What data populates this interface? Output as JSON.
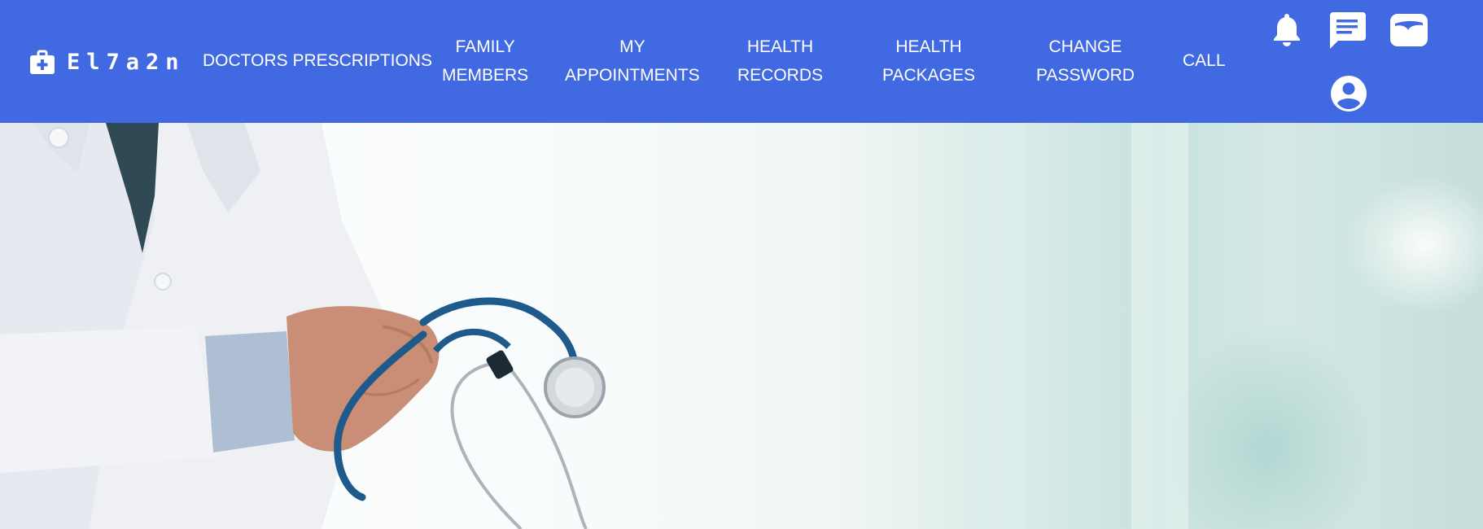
{
  "brand": {
    "name": "El7a2n",
    "icon": "medical-kit-icon"
  },
  "nav": {
    "items": [
      {
        "lines": [
          "DOCTORS PRESCRIPTIONS"
        ]
      },
      {
        "lines": [
          "FAMILY",
          "MEMBERS"
        ]
      },
      {
        "lines": [
          "MY",
          "APPOINTMENTS"
        ]
      },
      {
        "lines": [
          "HEALTH",
          "RECORDS"
        ]
      },
      {
        "lines": [
          "HEALTH",
          "PACKAGES"
        ]
      },
      {
        "lines": [
          "CHANGE",
          "PASSWORD"
        ]
      },
      {
        "lines": [
          "CALL"
        ]
      }
    ]
  },
  "actions": {
    "icons": [
      "bell-icon",
      "chat-icon",
      "wallet-icon",
      "account-icon"
    ]
  },
  "hero": {
    "image": "doctor-with-stethoscope-photo"
  },
  "colors": {
    "navbar": "#4169e1",
    "nav_text": "#ffffff"
  }
}
